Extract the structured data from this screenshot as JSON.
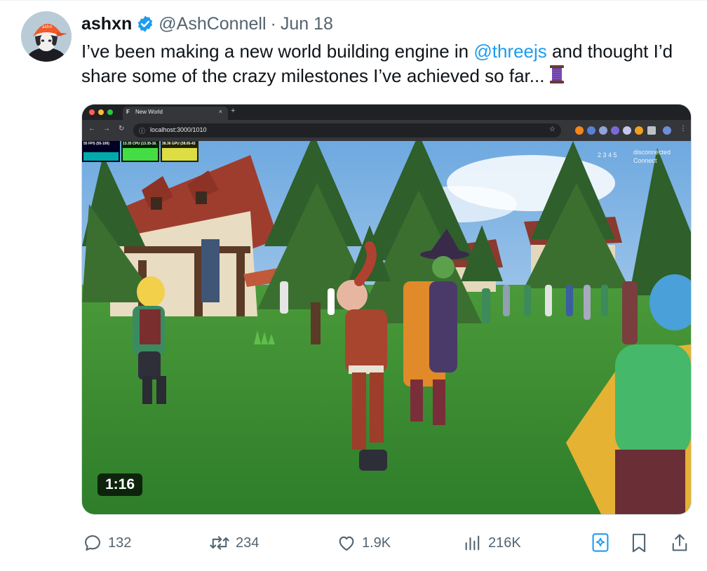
{
  "author": {
    "display_name": "ashxn",
    "handle": "@AshConnell",
    "separator": "·",
    "date": "Jun 18",
    "verified": true,
    "verified_color": "#1d9bf0"
  },
  "tweet": {
    "text_part1": "I’ve been making a new world building engine in ",
    "mention": "@threejs",
    "text_part2": " and thought I’d share some of the crazy milestones I’ve achieved so far...",
    "emoji_icon": "thread-spool-icon"
  },
  "video": {
    "duration": "1:16",
    "browser": {
      "tab_title": "New World",
      "tab_close": "×",
      "new_tab": "+",
      "url": "localhost:3000/1010"
    },
    "stats_panels": [
      {
        "label": "55 FPS (55-100)",
        "color": "#0ff",
        "bg": "#002"
      },
      {
        "label": "13.35 CPU (13.35-16.",
        "color": "#0f0",
        "bg": "#020"
      },
      {
        "label": "38.36 GPU (38.05-43",
        "color": "#ff0",
        "bg": "#220"
      }
    ],
    "hud_numbers": "2 3 4 5",
    "hud_status_1": "disconnected",
    "hud_status_2": "Connect"
  },
  "actions": {
    "replies": "132",
    "reposts": "234",
    "likes": "1.9K",
    "views": "216K",
    "accent": "#1d9bf0",
    "icon_color": "#536471"
  }
}
